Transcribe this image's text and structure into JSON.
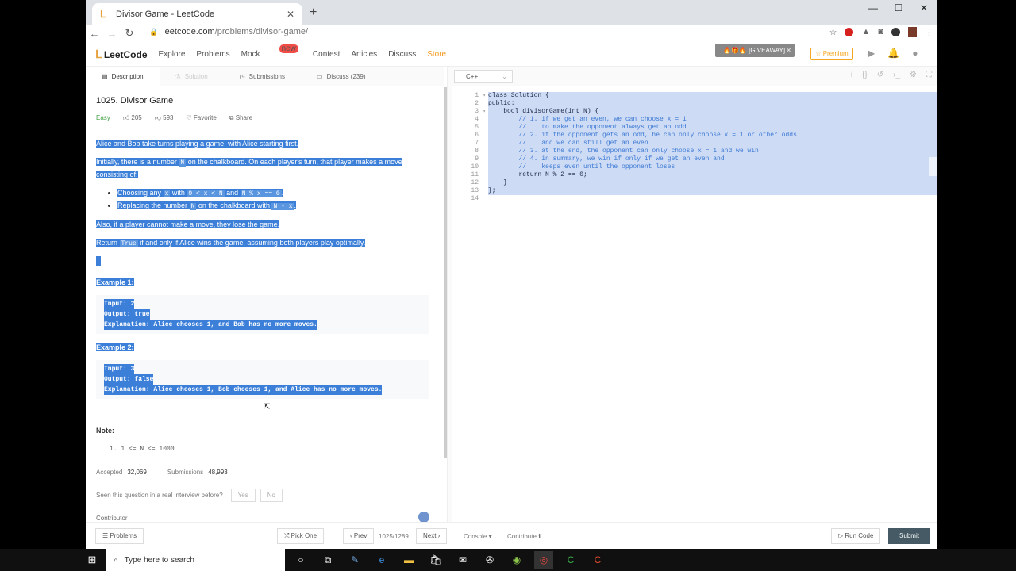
{
  "browser": {
    "tab_title": "Divisor Game - LeetCode",
    "url_domain": "leetcode.com",
    "url_path": "/problems/divisor-game/",
    "window_controls": [
      "—",
      "☐",
      "✕"
    ]
  },
  "nav": {
    "logo": "LeetCode",
    "links": [
      "Explore",
      "Problems",
      "Mock",
      "Contest",
      "Articles",
      "Discuss",
      "Store"
    ],
    "mock_badge": "new",
    "giveaway": "🔥🎁🔥 [GIVEAWAY]",
    "premium": "☆ Premium"
  },
  "subtabs": [
    "Description",
    "Solution",
    "Submissions",
    "Discuss (239)"
  ],
  "problem": {
    "title": "1025. Divisor Game",
    "difficulty": "Easy",
    "likes": "205",
    "dislikes": "593",
    "favorite": "Favorite",
    "share": "Share",
    "p1": "Alice and Bob take turns playing a game, with Alice starting first.",
    "p2a": "Initially, there is a number",
    "p2code": "N",
    "p2b": "on the chalkboard.  On each player's turn, that player makes a move consisting of:",
    "li1a": "Choosing any",
    "li1code1": "x",
    "li1b": "with",
    "li1code2": "0 < x < N",
    "li1c": "and",
    "li1code3": "N % x == 0",
    "li1d": ".",
    "li2a": "Replacing the number",
    "li2code1": "N",
    "li2b": "on the chalkboard with",
    "li2code2": "N - x",
    "li2c": ".",
    "p3": "Also, if a player cannot make a move, they lose the game.",
    "p4a": "Return",
    "p4code": "True",
    "p4b": "if and only if Alice wins the game, assuming both players play optimally.",
    "ex1_title": "Example 1:",
    "ex1": [
      "Input: 2",
      "Output: true",
      "Explanation: Alice chooses 1, and Bob has no more moves."
    ],
    "ex2_title": "Example 2:",
    "ex2": [
      "Input: 3",
      "Output: false",
      "Explanation: Alice chooses 1, Bob chooses 1, and Alice has no more moves."
    ],
    "note_title": "Note:",
    "note": "1.  1 <= N <= 1000",
    "accepted_label": "Accepted",
    "accepted": "32,069",
    "submissions_label": "Submissions",
    "submissions": "48,993",
    "seen": "Seen this question in a real interview before?",
    "yes": "Yes",
    "no": "No",
    "contributor": "Contributor"
  },
  "editor": {
    "language": "C++",
    "line_numbers": [
      "1",
      "2",
      "3",
      "4",
      "5",
      "6",
      "7",
      "8",
      "9",
      "10",
      "11",
      "12",
      "13",
      "14"
    ],
    "lines": [
      "class Solution {",
      "public:",
      "    bool divisorGame(int N) {",
      "        // 1. if we get an even, we can choose x = 1",
      "        //    to make the opponent always get an odd",
      "        // 2. if the opponent gets an odd, he can only choose x = 1 or other odds",
      "        //    and we can still get an even",
      "        // 3. at the end, the opponent can only choose x = 1 and we win",
      "        // 4. in summary, we win if only if we get an even and",
      "        //    keeps even until the opponent loses",
      "        return N % 2 == 0;",
      "    }",
      "};",
      ""
    ]
  },
  "footer": {
    "problems": "☰ Problems",
    "pick_one": "⤮ Pick One",
    "prev": "‹ Prev",
    "page": "1025/1289",
    "next": "Next ›",
    "console": "Console ▾",
    "contribute": "Contribute ℹ",
    "run_code": "▷ Run Code",
    "submit": "Submit"
  },
  "taskbar": {
    "search_placeholder": "Type here to search"
  }
}
